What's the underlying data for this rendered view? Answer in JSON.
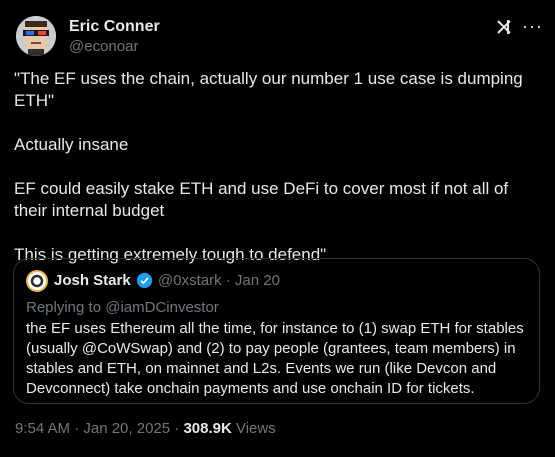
{
  "author": {
    "name": "Eric Conner",
    "handle": "@econoar"
  },
  "icons": {
    "grok": "grok-icon",
    "more": "more-icon",
    "verified": "verified-badge-icon"
  },
  "tweet": {
    "paragraphs": [
      "\"The EF uses the chain, actually our number 1 use case is dumping ETH\"",
      "Actually insane",
      "EF could easily stake ETH and use DeFi to cover most if not all of their internal budget"
    ],
    "last_line": "This is getting extremely tough to defend\""
  },
  "quote": {
    "name": "Josh Stark",
    "handle_date": "@0xstark · Jan 20",
    "replying_to": "Replying to @iamDCinvestor",
    "text": "the EF uses Ethereum all the time, for instance to (1) swap ETH for stables (usually @CoWSwap) and (2) to pay people (grantees, team members) in stables and ETH, on mainnet and L2s. Events we run (like Devcon and Devconnect) take onchain payments and use onchain ID for tickets."
  },
  "meta": {
    "timestamp": "9:54 AM · Jan 20, 2025 · ",
    "views_count": "308.9K",
    "views_label": " Views"
  },
  "colors": {
    "background": "#000000",
    "text": "#e7e9ea",
    "muted": "#71767b",
    "border": "#2f3336",
    "verified": "#1d9bf0"
  }
}
